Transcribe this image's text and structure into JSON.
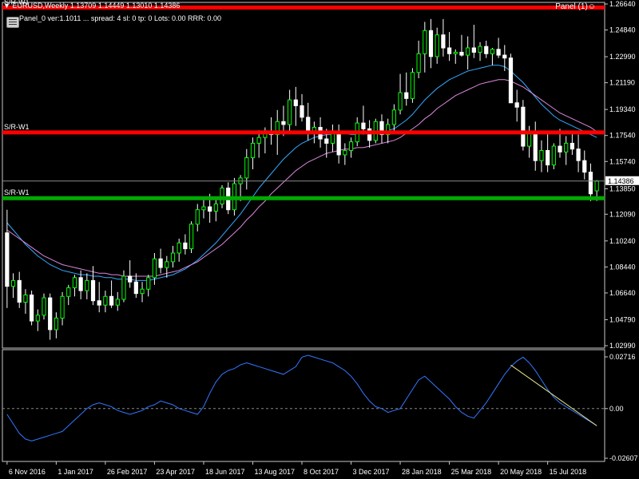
{
  "header": {
    "symbol_line": "EURUSD,Weekly  1.13709 1.14449 1.13010 1.14386",
    "panel_line": "Panel_0 ver:1.1011 ... spread: 4   sl: 0   tp: 0   Lots: 0.00   RRR: 0.00",
    "panel_button": "Panel (1)☺"
  },
  "chart_data": [
    {
      "type": "candlestick",
      "symbol": "EURUSD",
      "timeframe": "Weekly",
      "last_bar": {
        "open": 1.13709,
        "high": 1.14449,
        "low": 1.1301,
        "close": 1.14386
      },
      "current_price_label": "1.14386",
      "extra_price_label": "1.13850",
      "y_ticks": [
        "1.26640",
        "1.24840",
        "1.22990",
        "1.21190",
        "1.19340",
        "1.17540",
        "1.15740",
        "1.13850",
        "1.12090",
        "1.10240",
        "1.08440",
        "1.06640",
        "1.04790",
        "1.02990"
      ],
      "ylim": [
        1.0299,
        1.2664
      ],
      "x_ticks": [
        "6 Nov 2016",
        "1 Jan 2017",
        "26 Feb 2017",
        "23 Apr 2017",
        "18 Jun 2017",
        "13 Aug 2017",
        "8 Oct 2017",
        "3 Dec 2017",
        "28 Jan 2018",
        "25 Mar 2018",
        "20 May 2018",
        "15 Jul 2018"
      ],
      "ohlc": [
        [
          1.108,
          1.124,
          1.056,
          1.071
        ],
        [
          1.071,
          1.08,
          1.063,
          1.075
        ],
        [
          1.075,
          1.081,
          1.056,
          1.06
        ],
        [
          1.06,
          1.069,
          1.052,
          1.065
        ],
        [
          1.065,
          1.068,
          1.044,
          1.047
        ],
        [
          1.047,
          1.055,
          1.04,
          1.051
        ],
        [
          1.051,
          1.066,
          1.048,
          1.063
        ],
        [
          1.063,
          1.066,
          1.034,
          1.041
        ],
        [
          1.041,
          1.053,
          1.035,
          1.049
        ],
        [
          1.049,
          1.067,
          1.044,
          1.064
        ],
        [
          1.064,
          1.072,
          1.058,
          1.07
        ],
        [
          1.07,
          1.079,
          1.064,
          1.077
        ],
        [
          1.077,
          1.082,
          1.062,
          1.068
        ],
        [
          1.068,
          1.08,
          1.062,
          1.075
        ],
        [
          1.075,
          1.085,
          1.058,
          1.061
        ],
        [
          1.061,
          1.074,
          1.053,
          1.058
        ],
        [
          1.058,
          1.068,
          1.053,
          1.064
        ],
        [
          1.064,
          1.075,
          1.056,
          1.058
        ],
        [
          1.058,
          1.067,
          1.054,
          1.062
        ],
        [
          1.062,
          1.082,
          1.06,
          1.078
        ],
        [
          1.078,
          1.089,
          1.07,
          1.074
        ],
        [
          1.074,
          1.08,
          1.063,
          1.066
        ],
        [
          1.066,
          1.074,
          1.06,
          1.069
        ],
        [
          1.069,
          1.079,
          1.064,
          1.077
        ],
        [
          1.077,
          1.094,
          1.072,
          1.09
        ],
        [
          1.09,
          1.097,
          1.08,
          1.084
        ],
        [
          1.084,
          1.092,
          1.077,
          1.088
        ],
        [
          1.088,
          1.099,
          1.084,
          1.094
        ],
        [
          1.094,
          1.104,
          1.088,
          1.101
        ],
        [
          1.101,
          1.107,
          1.093,
          1.097
        ],
        [
          1.097,
          1.116,
          1.094,
          1.114
        ],
        [
          1.114,
          1.128,
          1.109,
          1.124
        ],
        [
          1.124,
          1.132,
          1.118,
          1.126
        ],
        [
          1.126,
          1.135,
          1.115,
          1.123
        ],
        [
          1.123,
          1.131,
          1.116,
          1.128
        ],
        [
          1.128,
          1.141,
          1.125,
          1.139
        ],
        [
          1.139,
          1.143,
          1.121,
          1.124
        ],
        [
          1.124,
          1.146,
          1.12,
          1.142
        ],
        [
          1.142,
          1.148,
          1.13,
          1.146
        ],
        [
          1.146,
          1.166,
          1.138,
          1.16
        ],
        [
          1.16,
          1.174,
          1.152,
          1.17
        ],
        [
          1.17,
          1.179,
          1.16,
          1.174
        ],
        [
          1.174,
          1.181,
          1.163,
          1.178
        ],
        [
          1.178,
          1.188,
          1.169,
          1.176
        ],
        [
          1.176,
          1.193,
          1.162,
          1.185
        ],
        [
          1.185,
          1.196,
          1.175,
          1.183
        ],
        [
          1.183,
          1.207,
          1.178,
          1.2
        ],
        [
          1.2,
          1.209,
          1.182,
          1.196
        ],
        [
          1.196,
          1.204,
          1.185,
          1.188
        ],
        [
          1.188,
          1.198,
          1.172,
          1.178
        ],
        [
          1.178,
          1.185,
          1.17,
          1.181
        ],
        [
          1.181,
          1.188,
          1.167,
          1.173
        ],
        [
          1.173,
          1.18,
          1.16,
          1.17
        ],
        [
          1.17,
          1.183,
          1.164,
          1.178
        ],
        [
          1.178,
          1.183,
          1.156,
          1.162
        ],
        [
          1.162,
          1.17,
          1.155,
          1.165
        ],
        [
          1.165,
          1.174,
          1.16,
          1.171
        ],
        [
          1.171,
          1.188,
          1.168,
          1.184
        ],
        [
          1.184,
          1.196,
          1.176,
          1.18
        ],
        [
          1.18,
          1.186,
          1.167,
          1.172
        ],
        [
          1.172,
          1.187,
          1.17,
          1.185
        ],
        [
          1.185,
          1.19,
          1.17,
          1.176
        ],
        [
          1.176,
          1.187,
          1.17,
          1.183
        ],
        [
          1.183,
          1.197,
          1.178,
          1.193
        ],
        [
          1.193,
          1.218,
          1.19,
          1.205
        ],
        [
          1.205,
          1.219,
          1.196,
          1.201
        ],
        [
          1.201,
          1.222,
          1.198,
          1.219
        ],
        [
          1.219,
          1.241,
          1.215,
          1.232
        ],
        [
          1.232,
          1.254,
          1.219,
          1.248
        ],
        [
          1.248,
          1.256,
          1.222,
          1.23
        ],
        [
          1.23,
          1.25,
          1.225,
          1.245
        ],
        [
          1.245,
          1.256,
          1.23,
          1.236
        ],
        [
          1.236,
          1.247,
          1.227,
          1.232
        ],
        [
          1.232,
          1.235,
          1.225,
          1.233
        ],
        [
          1.233,
          1.245,
          1.23,
          1.231
        ],
        [
          1.231,
          1.244,
          1.221,
          1.236
        ],
        [
          1.236,
          1.252,
          1.229,
          1.233
        ],
        [
          1.233,
          1.24,
          1.227,
          1.237
        ],
        [
          1.237,
          1.241,
          1.229,
          1.232
        ],
        [
          1.232,
          1.236,
          1.224,
          1.235
        ],
        [
          1.235,
          1.243,
          1.229,
          1.231
        ],
        [
          1.231,
          1.238,
          1.22,
          1.229
        ],
        [
          1.229,
          1.232,
          1.209,
          1.198
        ],
        [
          1.198,
          1.207,
          1.185,
          1.195
        ],
        [
          1.195,
          1.2,
          1.165,
          1.168
        ],
        [
          1.168,
          1.182,
          1.16,
          1.178
        ],
        [
          1.178,
          1.185,
          1.151,
          1.158
        ],
        [
          1.158,
          1.172,
          1.15,
          1.165
        ],
        [
          1.165,
          1.178,
          1.15,
          1.155
        ],
        [
          1.155,
          1.17,
          1.152,
          1.168
        ],
        [
          1.168,
          1.18,
          1.16,
          1.164
        ],
        [
          1.164,
          1.175,
          1.155,
          1.17
        ],
        [
          1.17,
          1.178,
          1.162,
          1.166
        ],
        [
          1.166,
          1.176,
          1.15,
          1.158
        ],
        [
          1.158,
          1.165,
          1.145,
          1.15
        ],
        [
          1.15,
          1.156,
          1.13,
          1.135
        ],
        [
          1.13709,
          1.14449,
          1.1301,
          1.14386
        ]
      ],
      "moving_averages": [
        {
          "color": "#33aaff",
          "values": [
            1.115,
            1.11,
            1.105,
            1.1,
            1.096,
            1.092,
            1.089,
            1.086,
            1.084,
            1.082,
            1.081,
            1.08,
            1.079,
            1.079,
            1.078,
            1.078,
            1.077,
            1.077,
            1.076,
            1.076,
            1.076,
            1.075,
            1.075,
            1.075,
            1.076,
            1.077,
            1.078,
            1.079,
            1.081,
            1.083,
            1.086,
            1.089,
            1.093,
            1.097,
            1.101,
            1.106,
            1.111,
            1.116,
            1.121,
            1.127,
            1.133,
            1.139,
            1.144,
            1.149,
            1.154,
            1.159,
            1.163,
            1.167,
            1.17,
            1.172,
            1.174,
            1.175,
            1.176,
            1.176,
            1.177,
            1.177,
            1.176,
            1.176,
            1.177,
            1.177,
            1.178,
            1.178,
            1.179,
            1.18,
            1.183,
            1.186,
            1.19,
            1.195,
            1.2,
            1.204,
            1.208,
            1.211,
            1.214,
            1.216,
            1.218,
            1.22,
            1.221,
            1.222,
            1.223,
            1.224,
            1.224,
            1.223,
            1.22,
            1.216,
            1.212,
            1.207,
            1.202,
            1.197,
            1.193,
            1.189,
            1.186,
            1.184,
            1.182,
            1.18,
            1.178,
            1.176,
            1.174
          ]
        },
        {
          "color": "#dd88dd",
          "values": [
            1.11,
            1.107,
            1.104,
            1.101,
            1.098,
            1.095,
            1.092,
            1.09,
            1.088,
            1.086,
            1.085,
            1.084,
            1.083,
            1.082,
            1.081,
            1.08,
            1.08,
            1.079,
            1.079,
            1.078,
            1.078,
            1.078,
            1.078,
            1.078,
            1.078,
            1.079,
            1.08,
            1.081,
            1.082,
            1.084,
            1.086,
            1.088,
            1.091,
            1.094,
            1.097,
            1.1,
            1.104,
            1.108,
            1.112,
            1.117,
            1.121,
            1.126,
            1.13,
            1.135,
            1.139,
            1.143,
            1.147,
            1.151,
            1.154,
            1.157,
            1.159,
            1.161,
            1.163,
            1.164,
            1.165,
            1.166,
            1.166,
            1.167,
            1.167,
            1.168,
            1.169,
            1.17,
            1.171,
            1.172,
            1.174,
            1.177,
            1.18,
            1.183,
            1.187,
            1.19,
            1.194,
            1.197,
            1.2,
            1.203,
            1.205,
            1.207,
            1.209,
            1.211,
            1.212,
            1.213,
            1.214,
            1.214,
            1.213,
            1.211,
            1.209,
            1.206,
            1.203,
            1.2,
            1.197,
            1.194,
            1.191,
            1.189,
            1.187,
            1.185,
            1.183,
            1.181,
            1.178
          ]
        }
      ],
      "levels": [
        {
          "label": "S/R-W1",
          "price": 1.264,
          "color": "#ff0000"
        },
        {
          "label": "S/R-W1",
          "price": 1.1775,
          "color": "#ff0000"
        },
        {
          "label": "S/R-W1",
          "price": 1.132,
          "color": "#00aa00"
        }
      ]
    },
    {
      "type": "line",
      "y_ticks": [
        "0.02716",
        "0.00",
        "-0.02607"
      ],
      "ylim": [
        -0.02607,
        0.02716
      ],
      "values": [
        -0.003,
        -0.008,
        -0.013,
        -0.016,
        -0.017,
        -0.016,
        -0.015,
        -0.014,
        -0.013,
        -0.012,
        -0.009,
        -0.006,
        -0.003,
        0.0,
        0.002,
        0.003,
        0.002,
        0.001,
        -0.001,
        -0.002,
        -0.003,
        -0.002,
        -0.001,
        0.001,
        0.002,
        0.004,
        0.003,
        0.002,
        0.0,
        -0.001,
        -0.002,
        -0.003,
        0.001,
        0.008,
        0.014,
        0.018,
        0.02,
        0.021,
        0.023,
        0.024,
        0.023,
        0.022,
        0.021,
        0.02,
        0.019,
        0.018,
        0.02,
        0.022,
        0.027,
        0.028,
        0.027,
        0.026,
        0.025,
        0.024,
        0.022,
        0.02,
        0.017,
        0.013,
        0.008,
        0.004,
        0.001,
        0.0,
        -0.002,
        -0.001,
        0.0,
        0.005,
        0.01,
        0.015,
        0.017,
        0.014,
        0.011,
        0.008,
        0.005,
        0.001,
        -0.002,
        -0.004,
        -0.005,
        -0.001,
        0.003,
        0.008,
        0.013,
        0.018,
        0.022,
        0.025,
        0.027,
        0.024,
        0.02,
        0.015,
        0.01,
        0.006,
        0.003,
        0.001,
        -0.001,
        -0.003,
        -0.005,
        -0.007,
        -0.009
      ]
    }
  ]
}
